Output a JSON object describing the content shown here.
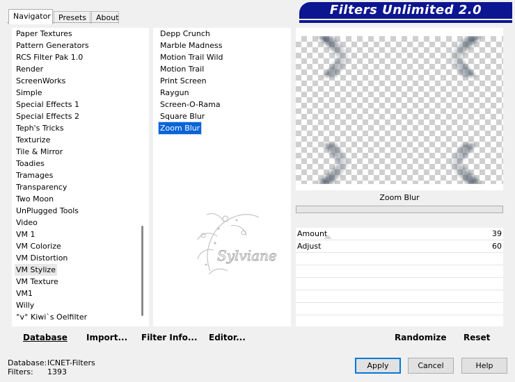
{
  "tabs": [
    {
      "label": "Navigator"
    },
    {
      "label": "Presets"
    },
    {
      "label": "About"
    }
  ],
  "banner": {
    "title": "Filters Unlimited 2.0"
  },
  "categories": {
    "items": [
      "Paper Textures",
      "Pattern Generators",
      "RCS Filter Pak 1.0",
      "Render",
      "ScreenWorks",
      "Simple",
      "Special Effects 1",
      "Special Effects 2",
      "Teph's Tricks",
      "Texturize",
      "Tile & Mirror",
      "Toadies",
      "Tramages",
      "Transparency",
      "Two Moon",
      "UnPlugged Tools",
      "Video",
      "VM 1",
      "VM Colorize",
      "VM Distortion",
      "VM Stylize",
      "VM Texture",
      "VM1",
      "Willy",
      "°v° Kiwi`s Oelfilter"
    ],
    "highlighted": "VM Stylize"
  },
  "filters": {
    "items": [
      "Depp Crunch",
      "Marble Madness",
      "Motion Trail Wild",
      "Motion Trail",
      "Print Screen",
      "Raygun",
      "Screen-O-Rama",
      "Square Blur",
      "Zoom Blur"
    ],
    "selected": "Zoom Blur"
  },
  "watermark": {
    "text": "Sylviane"
  },
  "preview": {
    "filter_name": "Zoom Blur"
  },
  "params": [
    {
      "label": "Amount",
      "value": "39"
    },
    {
      "label": "Adjust",
      "value": "60"
    }
  ],
  "toolbar_left": {
    "database": "Database",
    "import": "Import...",
    "filter_info": "Filter Info...",
    "editor": "Editor..."
  },
  "toolbar_right": {
    "randomize": "Randomize",
    "reset": "Reset"
  },
  "status": {
    "database_label": "Database:",
    "database_value": "ICNET-Filters",
    "filters_label": "Filters:",
    "filters_value": "1393"
  },
  "buttons": {
    "apply": "Apply",
    "cancel": "Cancel",
    "help": "Help"
  },
  "colors": {
    "banner": "#0c1690",
    "selection": "#0a64d8"
  }
}
